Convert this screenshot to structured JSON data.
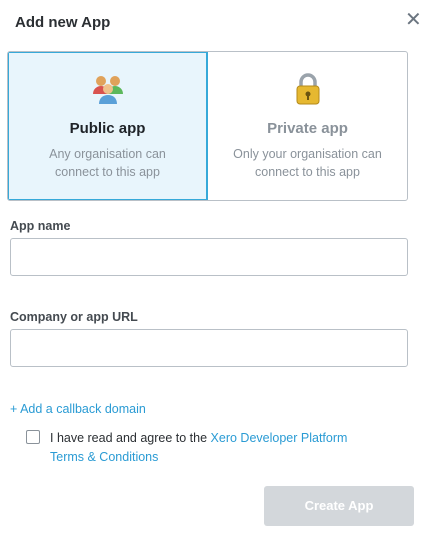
{
  "dialog": {
    "title": "Add new App",
    "close_icon": "close-icon"
  },
  "app_type": {
    "selected": "public",
    "options": [
      {
        "id": "public",
        "label": "Public app",
        "description_line1": "Any organisation can",
        "description_line2": "connect to this app",
        "icon": "users-group-icon"
      },
      {
        "id": "private",
        "label": "Private app",
        "description_line1": "Only your organisation can",
        "description_line2": "connect to this app",
        "icon": "padlock-icon"
      }
    ]
  },
  "form": {
    "app_name": {
      "label": "App name",
      "value": "",
      "placeholder": ""
    },
    "company_url": {
      "label": "Company or app URL",
      "value": "",
      "placeholder": ""
    },
    "callback_link": "+ Add a callback domain",
    "agree": {
      "checked": false,
      "text_prefix": "I have read and agree to the ",
      "terms_link_line1": "Xero Developer Platform",
      "terms_link_line2": "Terms & Conditions"
    },
    "submit_label": "Create App"
  },
  "colors": {
    "accent": "#36a9d9",
    "link": "#2a9bd4",
    "selected_bg": "#e8f5fc",
    "disabled_button": "#d3d7db"
  }
}
